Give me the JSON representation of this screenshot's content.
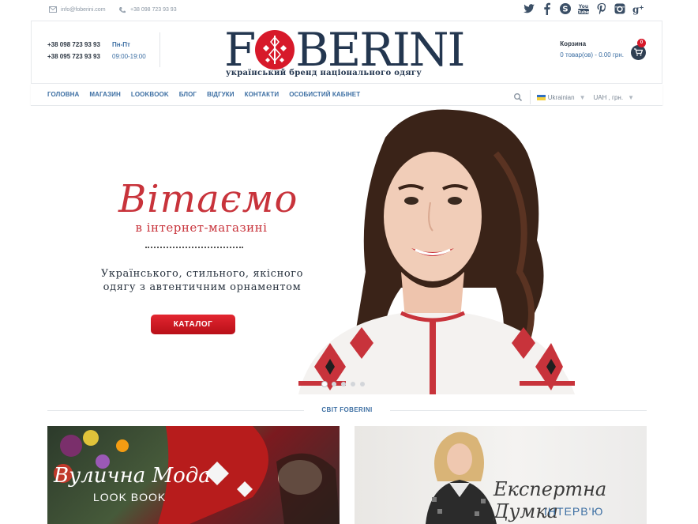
{
  "topbar": {
    "email": "info@foberini.com",
    "phone": "+38 098 723 93 93",
    "socials": [
      "twitter-icon",
      "facebook-icon",
      "skype-icon",
      "youtube-icon",
      "pinterest-icon",
      "instagram-icon",
      "googleplus-icon"
    ]
  },
  "header": {
    "phone1": "+38 098 723 93 93",
    "phone2": "+38 095 723 93 93",
    "days": "Пн-Пт",
    "hours": "09:00-19:00",
    "logo_text_left": "F",
    "logo_text_right": "BERINI",
    "tagline": "український бренд національного одягу",
    "cart_title": "Корзина",
    "cart_summary": "0 товар(ов) - 0.00 грн.",
    "cart_count": "0"
  },
  "nav": {
    "items": [
      "ГОЛОВНА",
      "МАГАЗИН",
      "LOOKBOOK",
      "БЛОГ",
      "ВІДГУКИ",
      "КОНТАКТИ",
      "ОСОБИСТИЙ КАБІНЕТ"
    ],
    "language": "Ukrainian",
    "currency": "UAH , грн."
  },
  "hero": {
    "title": "Вітаємо",
    "subtitle": "в інтернет-магазині",
    "description": "Українського, стильного, якісного одягу з автентичним орнаментом",
    "button": "КАТАЛОГ",
    "slides": 5,
    "active_slide": 1
  },
  "section": {
    "title": "СВІТ FOBERINI"
  },
  "cards": [
    {
      "title": "Вулична Мода",
      "subtitle": "LOOK BOOK"
    },
    {
      "title": "Експертна Думка",
      "subtitle": "ІНТЕРВ'Ю"
    }
  ],
  "colors": {
    "brand_navy": "#23364f",
    "brand_red": "#d7192a",
    "link_blue": "#3d6fa3",
    "hero_red": "#c8333b"
  }
}
